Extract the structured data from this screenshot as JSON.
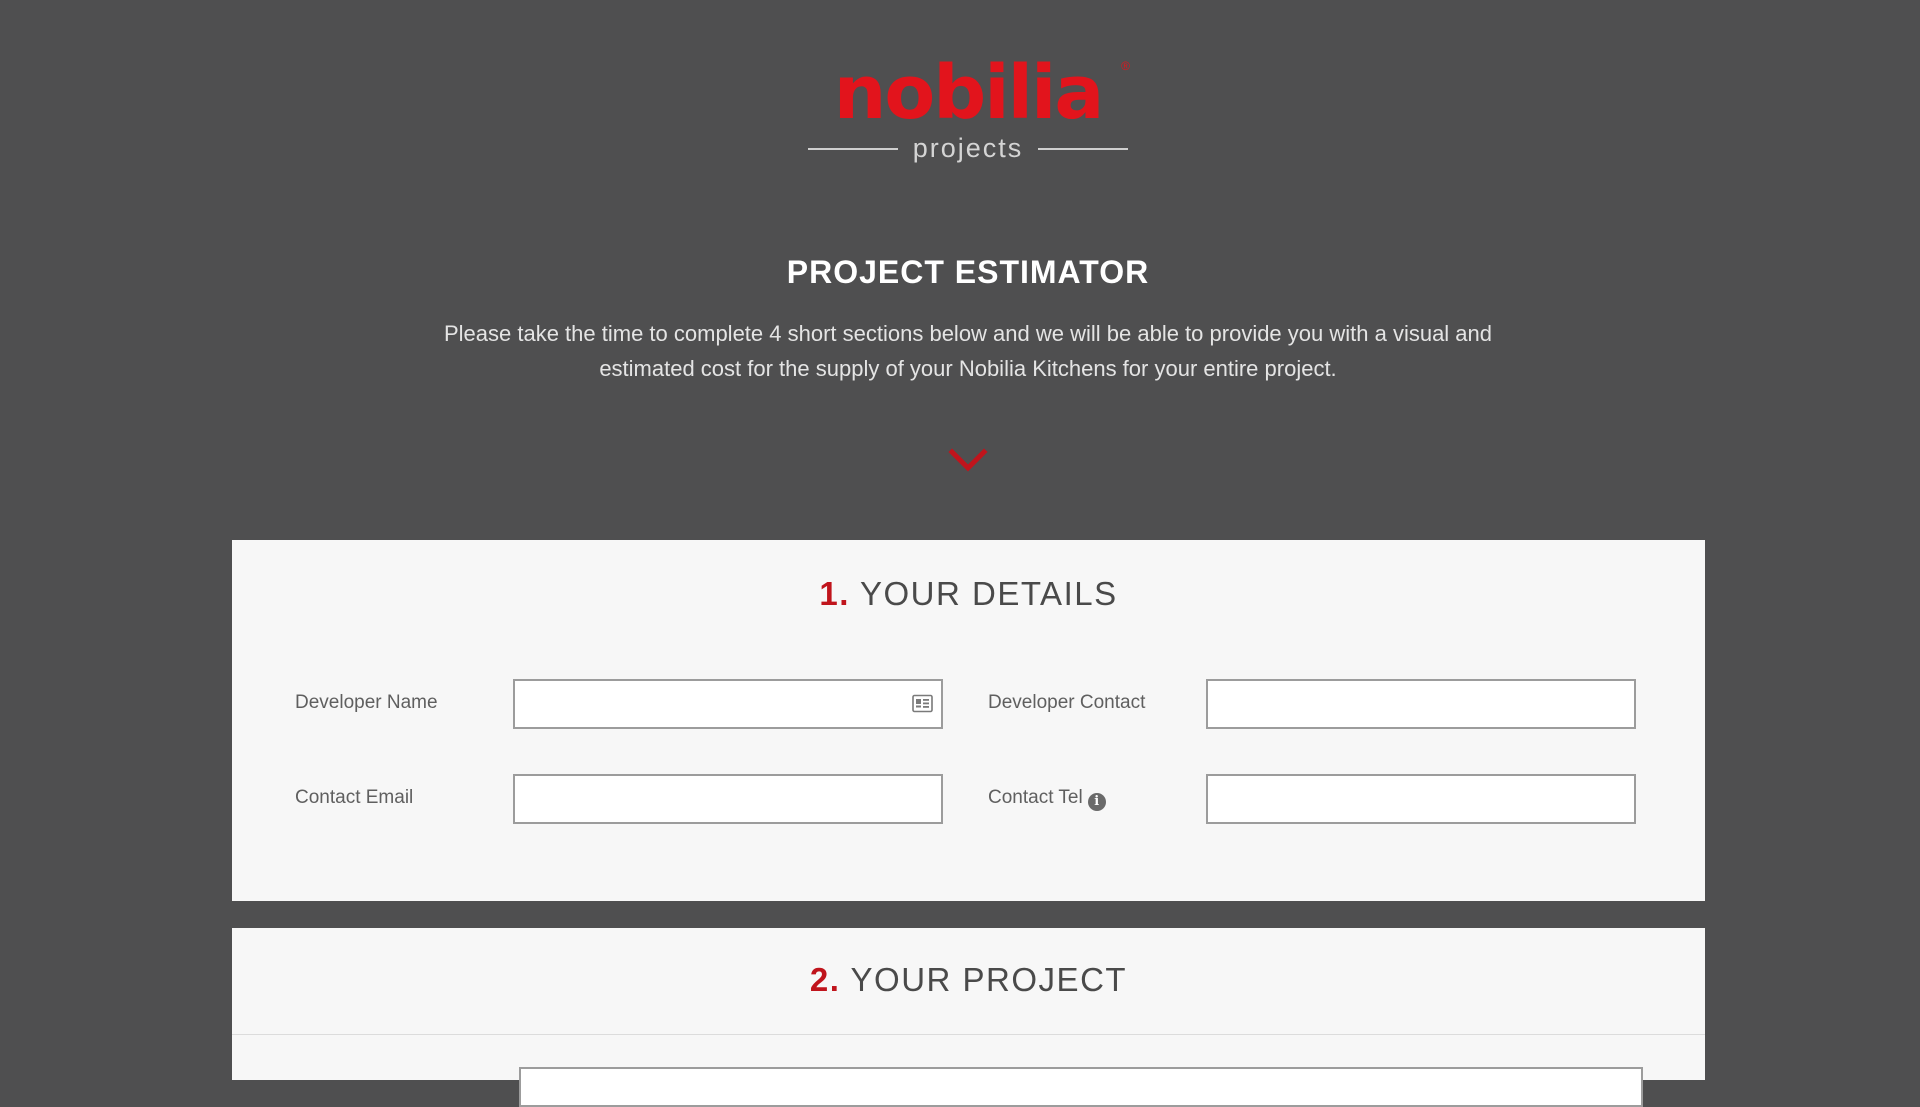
{
  "brand": {
    "wordmark": "nobilia",
    "registered_mark": "®",
    "subtitle": "projects",
    "color": "#e2141c"
  },
  "header": {
    "title": "PROJECT ESTIMATOR",
    "intro_line1": "Please take the time to complete 4 short sections below and we will be able to provide you with a visual and",
    "intro_line2": "estimated cost for the supply of your Nobilia Kitchens for your entire project.",
    "scroll_icon": "chevron-down-icon"
  },
  "section1": {
    "number": "1.",
    "title": "YOUR DETAILS",
    "fields": {
      "developer_name": {
        "label": "Developer Name",
        "value": "",
        "icon": "contact-card-icon"
      },
      "developer_contact": {
        "label": "Developer Contact",
        "value": ""
      },
      "contact_email": {
        "label": "Contact Email",
        "value": ""
      },
      "contact_tel": {
        "label": "Contact Tel",
        "value": "",
        "info_icon": "i"
      }
    }
  },
  "section2": {
    "number": "2.",
    "title": "YOUR PROJECT"
  },
  "colors": {
    "background": "#4f4f50",
    "card": "#f7f7f7",
    "accent": "#c0141c"
  }
}
